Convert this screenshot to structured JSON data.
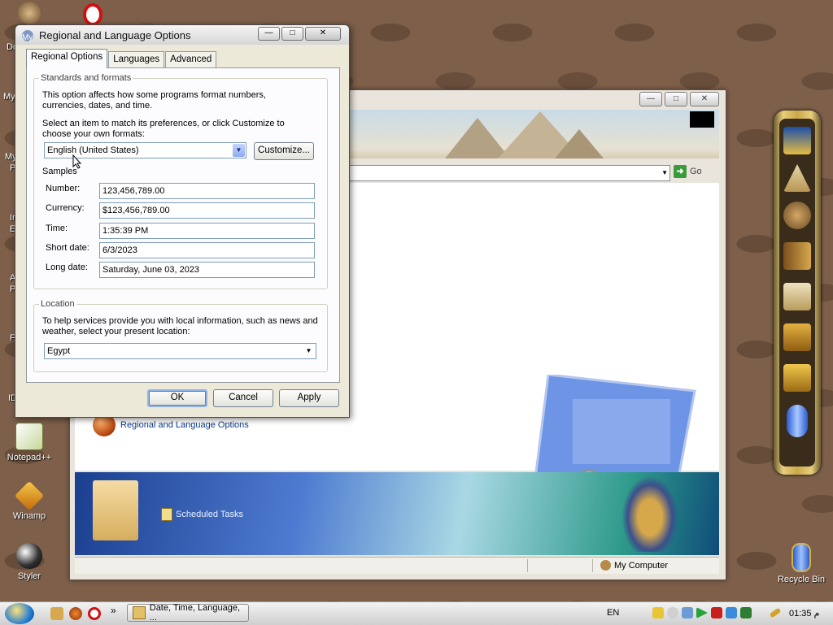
{
  "desktop": {
    "icons": [
      {
        "label": "Notepad++"
      },
      {
        "label": "Winamp"
      },
      {
        "label": "Styler"
      },
      {
        "label": "Recycle Bin"
      }
    ],
    "cut_labels": [
      "Doc",
      "My C",
      "My N",
      "Pl",
      "In",
      "Ex",
      "AC",
      "Pr",
      "Fo",
      "IDM"
    ]
  },
  "background_window": {
    "address_go": "Go",
    "items": {
      "regional": "Regional and Language Options",
      "scheduled": "Scheduled Tasks"
    },
    "status": {
      "location": "My Computer"
    }
  },
  "dialog": {
    "title": "Regional and Language Options",
    "title_prefix": "My",
    "tabs": [
      "Regional Options",
      "Languages",
      "Advanced"
    ],
    "standards": {
      "legend": "Standards and formats",
      "desc": "This option affects how some programs format numbers, currencies, dates, and time.",
      "select_desc": "Select an item to match its preferences, or click Customize to choose your own formats:",
      "selected_format": "English (United States)",
      "customize_label": "Customize...",
      "samples_label": "Samples",
      "samples": [
        {
          "label": "Number:",
          "value": "123,456,789.00"
        },
        {
          "label": "Currency:",
          "value": "$123,456,789.00"
        },
        {
          "label": "Time:",
          "value": "1:35:39 PM"
        },
        {
          "label": "Short date:",
          "value": "6/3/2023"
        },
        {
          "label": "Long date:",
          "value": "Saturday, June 03, 2023"
        }
      ]
    },
    "location": {
      "legend": "Location",
      "desc": "To help services provide you with local information, such as news and weather, select your present location:",
      "value": "Egypt"
    },
    "buttons": {
      "ok": "OK",
      "cancel": "Cancel",
      "apply": "Apply"
    }
  },
  "taskbar": {
    "task_label": "Date, Time, Language, ...",
    "lang": "EN",
    "clock": "01:35 م",
    "more": "»"
  },
  "colors": {
    "accent": "#316ac5",
    "panel": "#fcfcfe",
    "dialog_bg": "#ece9d8"
  }
}
